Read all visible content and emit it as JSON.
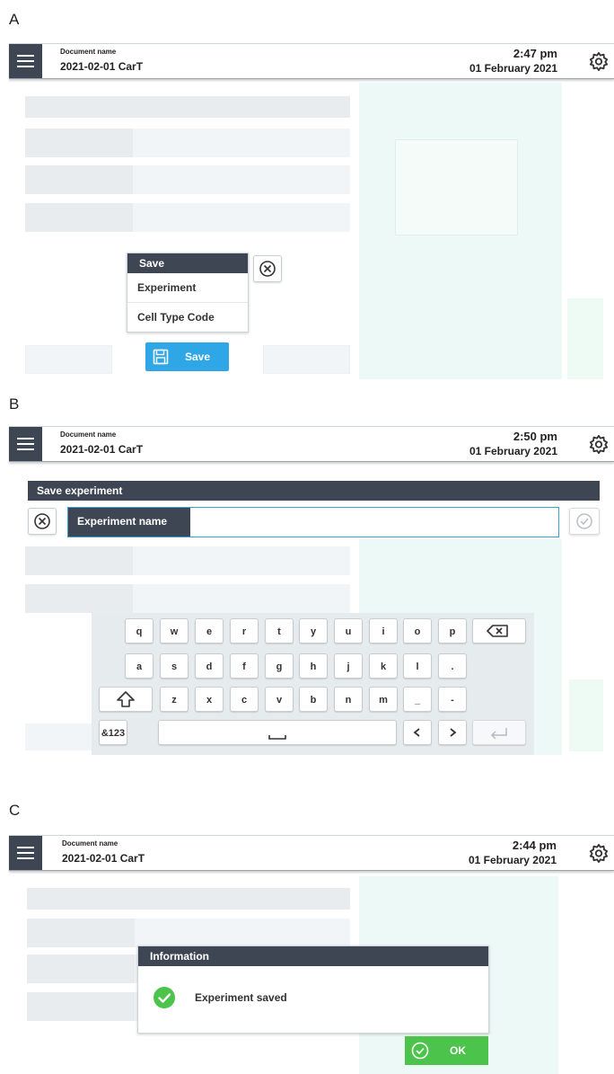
{
  "panels": [
    {
      "label": "A",
      "topbar": {
        "doc_label": "Document name",
        "doc_name": "2021-02-01 CarT",
        "time": "2:47 pm",
        "date": "01 February 2021"
      },
      "save_menu": {
        "title": "Save",
        "items": [
          "Experiment",
          "Cell Type Code"
        ]
      },
      "save_button": "Save"
    },
    {
      "label": "B",
      "topbar": {
        "doc_label": "Document name",
        "doc_name": "2021-02-01 CarT",
        "time": "2:50 pm",
        "date": "01 February 2021"
      },
      "dialog_title": "Save experiment",
      "input_label": "Experiment name",
      "input_value": "",
      "keyboard": {
        "row1": [
          "q",
          "w",
          "e",
          "r",
          "t",
          "y",
          "u",
          "i",
          "o",
          "p"
        ],
        "row2": [
          "a",
          "s",
          "d",
          "f",
          "g",
          "h",
          "j",
          "k",
          "l",
          "."
        ],
        "row3": [
          "z",
          "x",
          "c",
          "v",
          "b",
          "n",
          "m",
          "_",
          "-"
        ],
        "mode_key": "&123"
      }
    },
    {
      "label": "C",
      "topbar": {
        "doc_label": "Document name",
        "doc_name": "2021-02-01 CarT",
        "time": "2:44 pm",
        "date": "01 February 2021"
      },
      "info_title": "Information",
      "info_message": "Experiment saved",
      "ok_button": "OK"
    }
  ],
  "colors": {
    "header_dark": "#3e4654",
    "accent_blue": "#2fa7e6",
    "success_green": "#4cc34a"
  },
  "icons": [
    "menu-icon",
    "settings-icon",
    "close-circle-icon",
    "floppy-disk-icon",
    "backspace-icon",
    "shift-icon",
    "space-icon",
    "arrow-left-icon",
    "arrow-right-icon",
    "enter-icon",
    "confirm-check-icon",
    "check-circle-icon"
  ]
}
